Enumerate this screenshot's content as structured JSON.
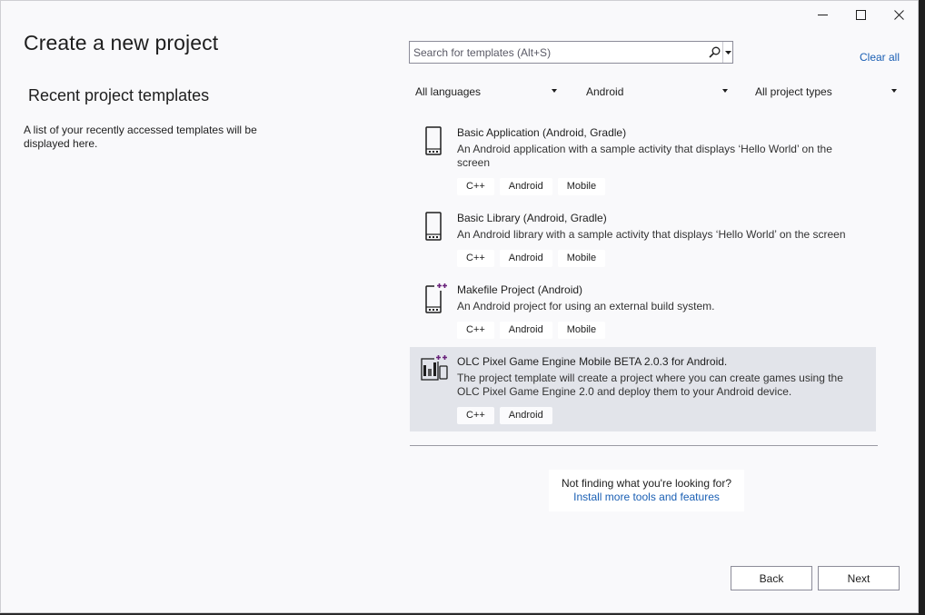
{
  "window": {
    "title": "Create a new project",
    "controls": [
      "minimize-icon",
      "maximize-icon",
      "close-icon"
    ]
  },
  "recent": {
    "heading": "Recent project templates",
    "empty_text": "A list of your recently accessed templates will be displayed here."
  },
  "search": {
    "placeholder": "Search for templates (Alt+S)",
    "value": ""
  },
  "clear_all_label": "Clear all",
  "filters": {
    "language": "All languages",
    "platform": "Android",
    "project_type": "All project types"
  },
  "templates": [
    {
      "title": "Basic Application (Android, Gradle)",
      "description": "An Android application with a sample activity that displays ‘Hello World’ on the screen",
      "tags": [
        "C++",
        "Android",
        "Mobile"
      ],
      "icon": "mobile-device-icon",
      "selected": false
    },
    {
      "title": "Basic Library (Android, Gradle)",
      "description": "An Android library with a sample activity that displays ‘Hello World’ on the screen",
      "tags": [
        "C++",
        "Android",
        "Mobile"
      ],
      "icon": "mobile-device-icon",
      "selected": false
    },
    {
      "title": "Makefile Project (Android)",
      "description": "An Android project for using an external build system.",
      "tags": [
        "C++",
        "Android",
        "Mobile"
      ],
      "icon": "mobile-cpp-icon",
      "selected": false
    },
    {
      "title": "OLC Pixel Game Engine Mobile BETA 2.0.3 for Android.",
      "description": "The project template will create a project where you can create games using the OLC Pixel Game Engine 2.0 and deploy them to your Android device.",
      "tags": [
        "C++",
        "Android"
      ],
      "icon": "game-engine-cpp-icon",
      "selected": true
    }
  ],
  "not_finding": {
    "question": "Not finding what you're looking for?",
    "link": "Install more tools and features"
  },
  "buttons": {
    "back": "Back",
    "next": "Next"
  },
  "colors": {
    "accent_link": "#1a5fb4",
    "selected_row": "#e2e4ea",
    "cpp_badge": "#68217a"
  }
}
